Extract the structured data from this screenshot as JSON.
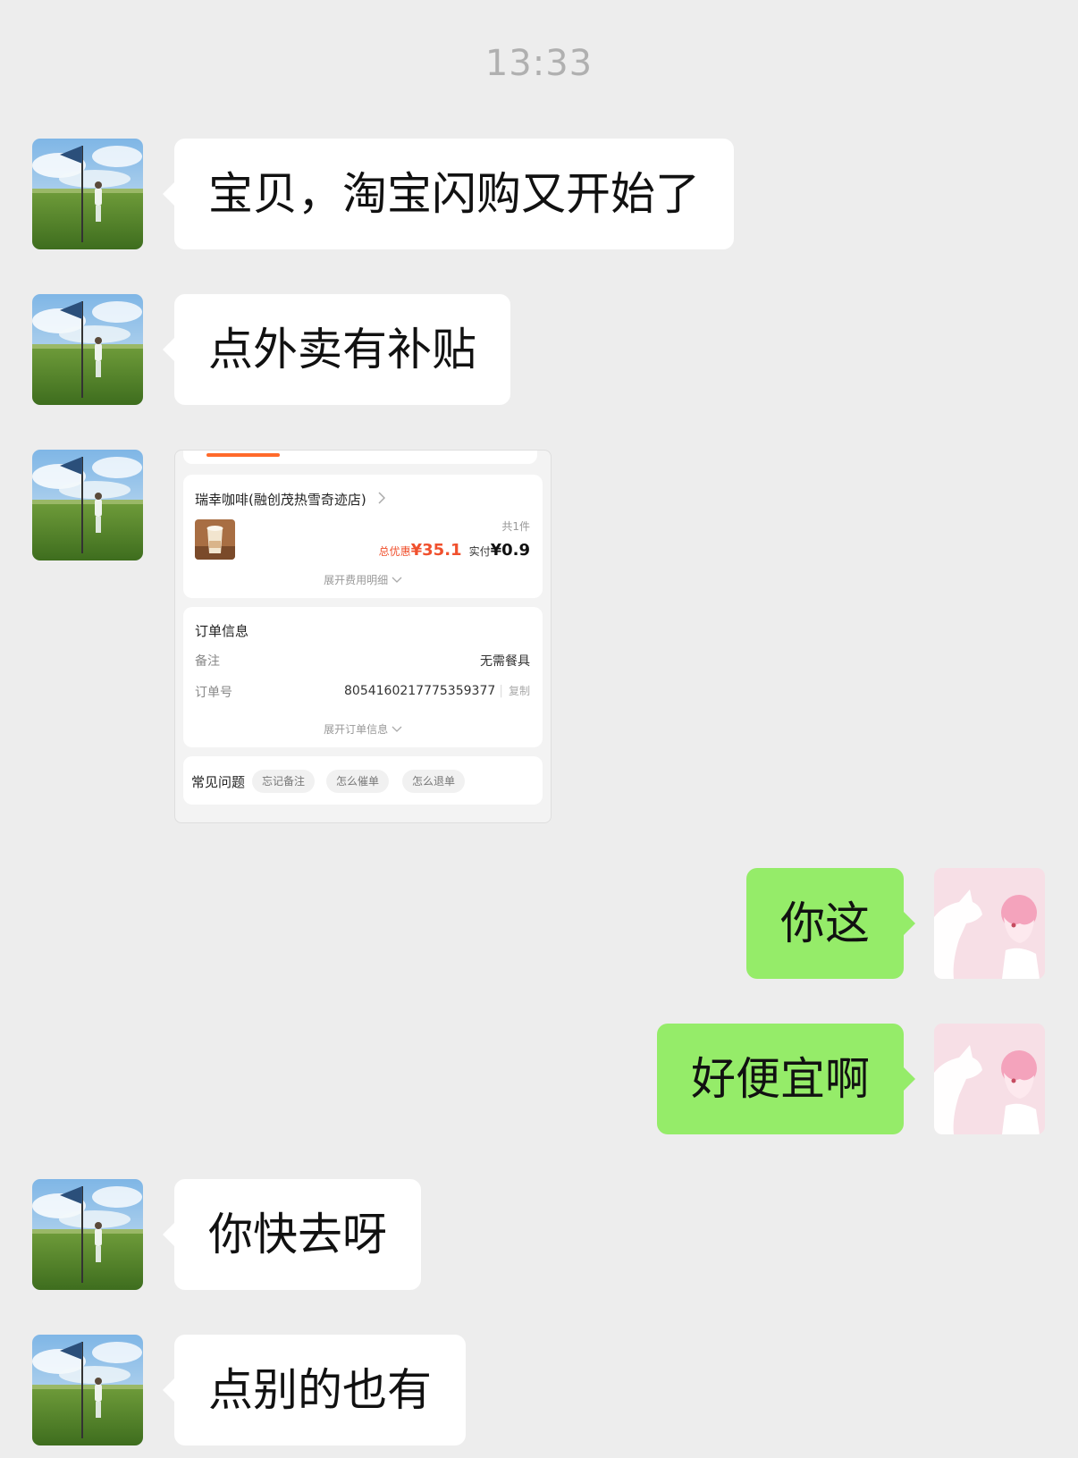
{
  "timestamp": "13:33",
  "messages": [
    {
      "text": "宝贝，淘宝闪购又开始了"
    },
    {
      "text": "点外卖有补贴"
    },
    {
      "text": "你这"
    },
    {
      "text": "好便宜啊"
    },
    {
      "text": "你快去呀"
    },
    {
      "text": "点别的也有"
    }
  ],
  "order_card": {
    "store_name": "瑞幸咖啡(融创茂热雪奇迹店)",
    "item_count": "共1件",
    "discount_label": "总优惠",
    "discount_value": "¥35.1",
    "paid_label": "实付",
    "paid_value": "¥0.9",
    "expand_fees": "展开费用明细",
    "order_info_title": "订单信息",
    "remark_label": "备注",
    "remark_value": "无需餐具",
    "order_no_label": "订单号",
    "order_no_value": "8054160217775359377",
    "copy_label": "复制",
    "expand_order": "展开订单信息",
    "faq_title": "常见问题",
    "faq_chips": [
      "忘记备注",
      "怎么催单",
      "怎么退单"
    ]
  },
  "colors": {
    "background": "#ededed",
    "outgoing_bubble": "#95ec69",
    "incoming_bubble": "#ffffff",
    "discount_red": "#f0502d"
  },
  "icons": {
    "contact_avatar": "golf-course-avatar",
    "self_avatar": "cat-and-girl-avatar"
  }
}
